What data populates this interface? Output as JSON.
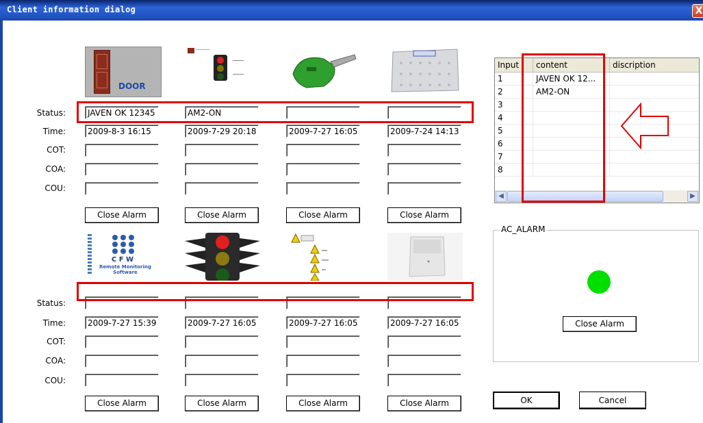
{
  "window": {
    "title": "Client information dialog",
    "close_glyph": "X"
  },
  "labels": {
    "status": "Status:",
    "time": "Time:",
    "cot": "COT:",
    "coa": "COA:",
    "cou": "COU:"
  },
  "close_alarm_label": "Close Alarm",
  "top_cards": [
    {
      "icon": "door-icon",
      "icon_text": "DOOR",
      "status": "JAVEN OK 12345",
      "time": "2009-8-3  16:15"
    },
    {
      "icon": "traffic-light-small-icon",
      "icon_text": "",
      "status": "AM2-ON",
      "time": "2009-7-29  20:18"
    },
    {
      "icon": "fuel-nozzle-icon",
      "icon_text": "",
      "status": "",
      "time": "2009-7-27  16:05"
    },
    {
      "icon": "junction-box-icon",
      "icon_text": "",
      "status": "",
      "time": "2009-7-24  14:13"
    }
  ],
  "bottom_cards": [
    {
      "icon": "cfw-logo-icon",
      "icon_text": "C F W",
      "icon_subtext": "Remote Monitoring Software",
      "status": "",
      "time": "2009-7-27  15:39"
    },
    {
      "icon": "traffic-light-large-icon",
      "icon_text": "",
      "status": "",
      "time": "2009-7-27  16:05"
    },
    {
      "icon": "warning-list-icon",
      "icon_text": "",
      "status": "",
      "time": "2009-7-27  16:05"
    },
    {
      "icon": "motion-sensor-icon",
      "icon_text": "",
      "status": "",
      "time": "2009-7-27  16:05"
    }
  ],
  "table": {
    "columns": [
      "Input",
      "content",
      "discription"
    ],
    "rows": [
      [
        "1",
        "JAVEN OK 12...",
        ""
      ],
      [
        "2",
        "AM2-ON",
        ""
      ],
      [
        "3",
        "",
        ""
      ],
      [
        "4",
        "",
        ""
      ],
      [
        "5",
        "",
        ""
      ],
      [
        "6",
        "",
        ""
      ],
      [
        "7",
        "",
        ""
      ],
      [
        "8",
        "",
        ""
      ]
    ]
  },
  "ac_alarm": {
    "label": "AC_ALARM",
    "led_color": "#00e000",
    "close_label": "Close Alarm"
  },
  "footer": {
    "ok_label": "OK",
    "cancel_label": "Cancel"
  },
  "colors": {
    "highlight": "#e00000",
    "titlebar": "#2458c8"
  }
}
